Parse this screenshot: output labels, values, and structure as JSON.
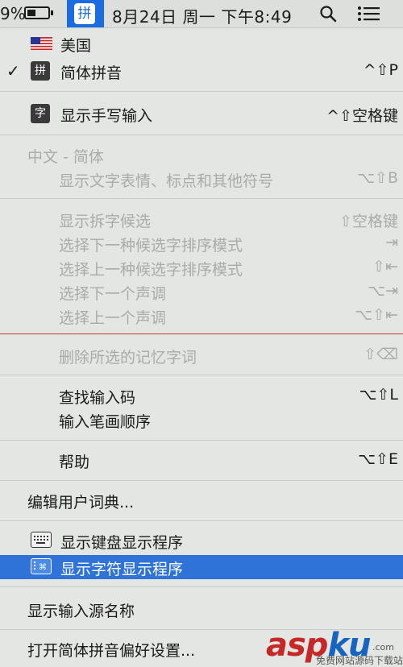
{
  "menubar": {
    "battery_pct": "9%",
    "im_icon_char": "拼",
    "datetime": "8月24日 周一 下午8:49",
    "icons": [
      "battery-icon",
      "pinyin-icon",
      "search-icon",
      "list-icon"
    ]
  },
  "menu": {
    "us": {
      "label": "美国",
      "icon": "us-flag-icon"
    },
    "pinyin": {
      "check": "✓",
      "icon_char": "拼",
      "label": "简体拼音",
      "shortcut": "^⇧P"
    },
    "handwriting": {
      "icon_char": "字",
      "label": "显示手写输入",
      "shortcut": "^⇧空格键"
    },
    "section_header": "中文 - 简体",
    "emoji": {
      "label": "显示文字表情、标点和其他符号",
      "shortcut": "⌥⇧B"
    },
    "split_candidates": {
      "label": "显示拆字候选",
      "shortcut": "⇧空格键"
    },
    "next_sort": {
      "label": "选择下一种候选字排序模式",
      "shortcut": "⇥"
    },
    "prev_sort": {
      "label": "选择上一种候选字排序模式",
      "shortcut": "⇧⇤"
    },
    "next_tone": {
      "label": "选择下一个声调",
      "shortcut": "⌥⇥"
    },
    "prev_tone": {
      "label": "选择上一个声调",
      "shortcut": "⌥⇧⇤"
    },
    "delete_memory": {
      "label": "删除所选的记忆字词",
      "shortcut": "⇧⌫"
    },
    "find_code": {
      "label": "查找输入码",
      "shortcut": "⌥⇧L"
    },
    "stroke_order": {
      "label": "输入笔画顺序"
    },
    "help": {
      "label": "帮助",
      "shortcut": "⌥⇧E"
    },
    "edit_dict": {
      "label": "编辑用户词典..."
    },
    "keyboard_viewer": {
      "label": "显示键盘显示程序",
      "icon": "keyboard-icon"
    },
    "character_viewer": {
      "label": "显示字符显示程序",
      "icon": "character-viewer-icon"
    },
    "show_source_name": {
      "label": "显示输入源名称"
    },
    "open_prefs": {
      "label": "打开简体拼音偏好设置..."
    }
  },
  "watermark": {
    "main_a": "asp",
    "main_b": "ku",
    "sub": "免费网站源码下载站",
    "dotcom": ".com"
  },
  "colors": {
    "highlight": "#2f73d9",
    "menubar_active": "#1b6ce0",
    "disabled_text": "#a9aca9"
  }
}
